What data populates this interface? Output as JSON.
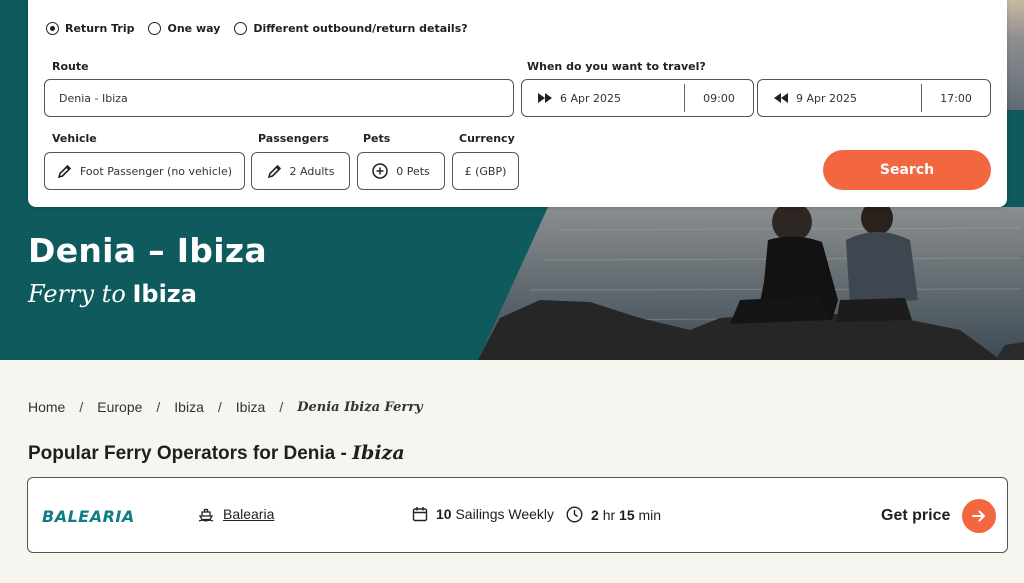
{
  "trip_type": {
    "options": [
      "Return Trip",
      "One way",
      "Different outbound/return details?"
    ],
    "selected": "Return Trip"
  },
  "route": {
    "label": "Route",
    "value": "Denia - Ibiza"
  },
  "travel": {
    "label": "When do you want to travel?",
    "outbound": {
      "date": "6 Apr 2025",
      "time": "09:00"
    },
    "return": {
      "date": "9 Apr 2025",
      "time": "17:00"
    }
  },
  "vehicle": {
    "label": "Vehicle",
    "value": "Foot Passenger (no vehicle)"
  },
  "passengers": {
    "label": "Passengers",
    "value": "2 Adults"
  },
  "pets": {
    "label": "Pets",
    "value": "0 Pets"
  },
  "currency": {
    "label": "Currency",
    "value": "£ (GBP)"
  },
  "search_label": "Search",
  "hero": {
    "title": "Denia – Ibiza",
    "subtitle_italic": "Ferry to",
    "subtitle_dest": "Ibiza"
  },
  "breadcrumb": [
    "Home",
    "Europe",
    "Ibiza",
    "Ibiza"
  ],
  "breadcrumb_current": "Denia Ibiza Ferry",
  "section": {
    "title_plain": "Popular Ferry Operators for Denia -",
    "title_italic": "Ibiza"
  },
  "operator": {
    "logo_text": "BALEARIA",
    "name": "Balearia",
    "sailings_count": "10",
    "sailings_text": "Sailings Weekly",
    "hours": "2",
    "hours_unit": "hr",
    "minutes": "15",
    "minutes_unit": "min",
    "price_label": "Get price"
  },
  "colors": {
    "accent": "#f26640",
    "hero_teal": "#0f5a5c",
    "brand": "#117c83"
  }
}
